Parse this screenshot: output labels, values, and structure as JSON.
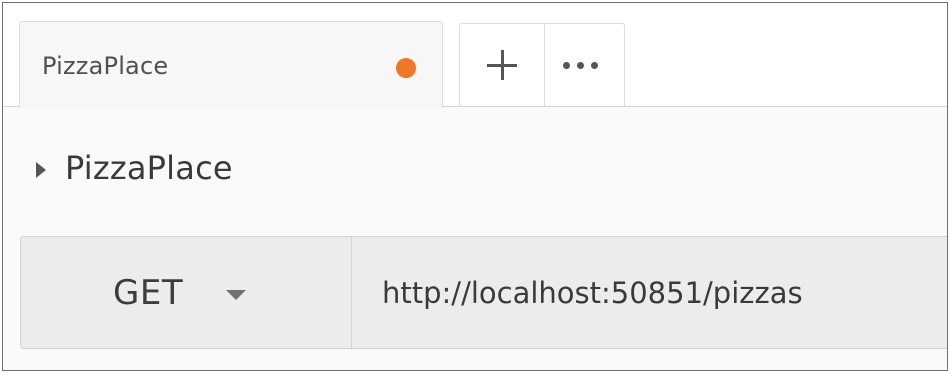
{
  "tabs": {
    "active_tab": {
      "label": "PizzaPlace",
      "unsaved_indicator_color": "#f07628",
      "unsaved_indicator_icon": "unsaved-dot-icon"
    },
    "new_tab_icon": "plus-icon",
    "more_tabs_icon": "ellipsis-icon"
  },
  "collection": {
    "expand_icon": "caret-right-icon",
    "name": "PizzaPlace"
  },
  "request": {
    "method": "GET",
    "method_dropdown_icon": "caret-down-icon",
    "url": "http://localhost:50851/pizzas"
  }
}
